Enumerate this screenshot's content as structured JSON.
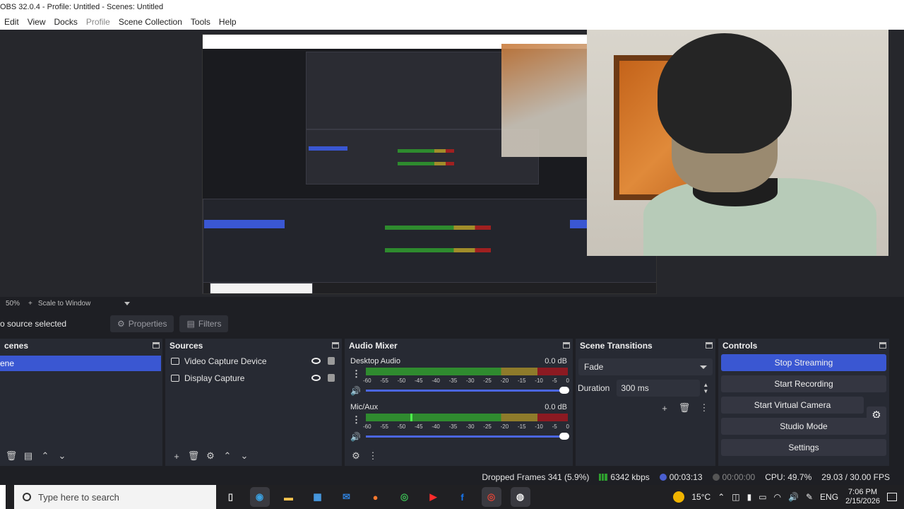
{
  "window": {
    "title": "OBS 32.0.4 - Profile: Untitled - Scenes: Untitled"
  },
  "menu": [
    {
      "label": "Edit",
      "enabled": true
    },
    {
      "label": "View",
      "enabled": true
    },
    {
      "label": "Docks",
      "enabled": true
    },
    {
      "label": "Profile",
      "enabled": false
    },
    {
      "label": "Scene Collection",
      "enabled": true
    },
    {
      "label": "Tools",
      "enabled": true
    },
    {
      "label": "Help",
      "enabled": true
    }
  ],
  "preview_bar": {
    "zoom": "50%",
    "plus": "+",
    "scale_mode": "Scale to Window"
  },
  "source_toolbar": {
    "no_selection": "o source selected",
    "properties": "Properties",
    "filters": "Filters"
  },
  "scenes": {
    "title": "cenes",
    "items": [
      "ene"
    ]
  },
  "sources": {
    "title": "Sources",
    "items": [
      {
        "name": "Video Capture Device",
        "icon": "camera-icon"
      },
      {
        "name": "Display Capture",
        "icon": "monitor-icon"
      }
    ]
  },
  "audio_mixer": {
    "title": "Audio Mixer",
    "scale": [
      "-60",
      "-55",
      "-50",
      "-45",
      "-40",
      "-35",
      "-30",
      "-25",
      "-20",
      "-15",
      "-10",
      "-5",
      "0"
    ],
    "channels": [
      {
        "name": "Desktop Audio",
        "db": "0.0 dB",
        "level": 0.0,
        "volume": 1.0
      },
      {
        "name": "Mic/Aux",
        "db": "0.0 dB",
        "level": 0.22,
        "volume": 1.0
      }
    ]
  },
  "scene_transitions": {
    "title": "Scene Transitions",
    "transition": "Fade",
    "duration_label": "Duration",
    "duration": "300 ms"
  },
  "controls": {
    "title": "Controls",
    "stop_streaming": "Stop Streaming",
    "start_recording": "Start Recording",
    "start_virtual_camera": "Start Virtual Camera",
    "studio_mode": "Studio Mode",
    "settings": "Settings"
  },
  "status": {
    "dropped_frames": "Dropped Frames 341 (5.9%)",
    "bitrate": "6342 kbps",
    "stream_time": "00:03:13",
    "record_time": "00:00:00",
    "cpu": "CPU: 49.7%",
    "fps": "29.03 / 30.00 FPS"
  },
  "taskbar": {
    "search_placeholder": "Type here to search",
    "apps": [
      "task-view-icon",
      "edge-icon",
      "file-explorer-icon",
      "store-icon",
      "outlook-icon",
      "firefox-icon",
      "chrome-icon",
      "youtube-icon",
      "facebook-icon",
      "chrome-icon",
      "obs-icon"
    ],
    "weather": "15°C",
    "language": "ENG",
    "time": "7:06 PM",
    "date": "2/15/2026"
  },
  "colors": {
    "accent": "#3a57d2",
    "panel": "#272a33",
    "background": "#1e1f24"
  }
}
